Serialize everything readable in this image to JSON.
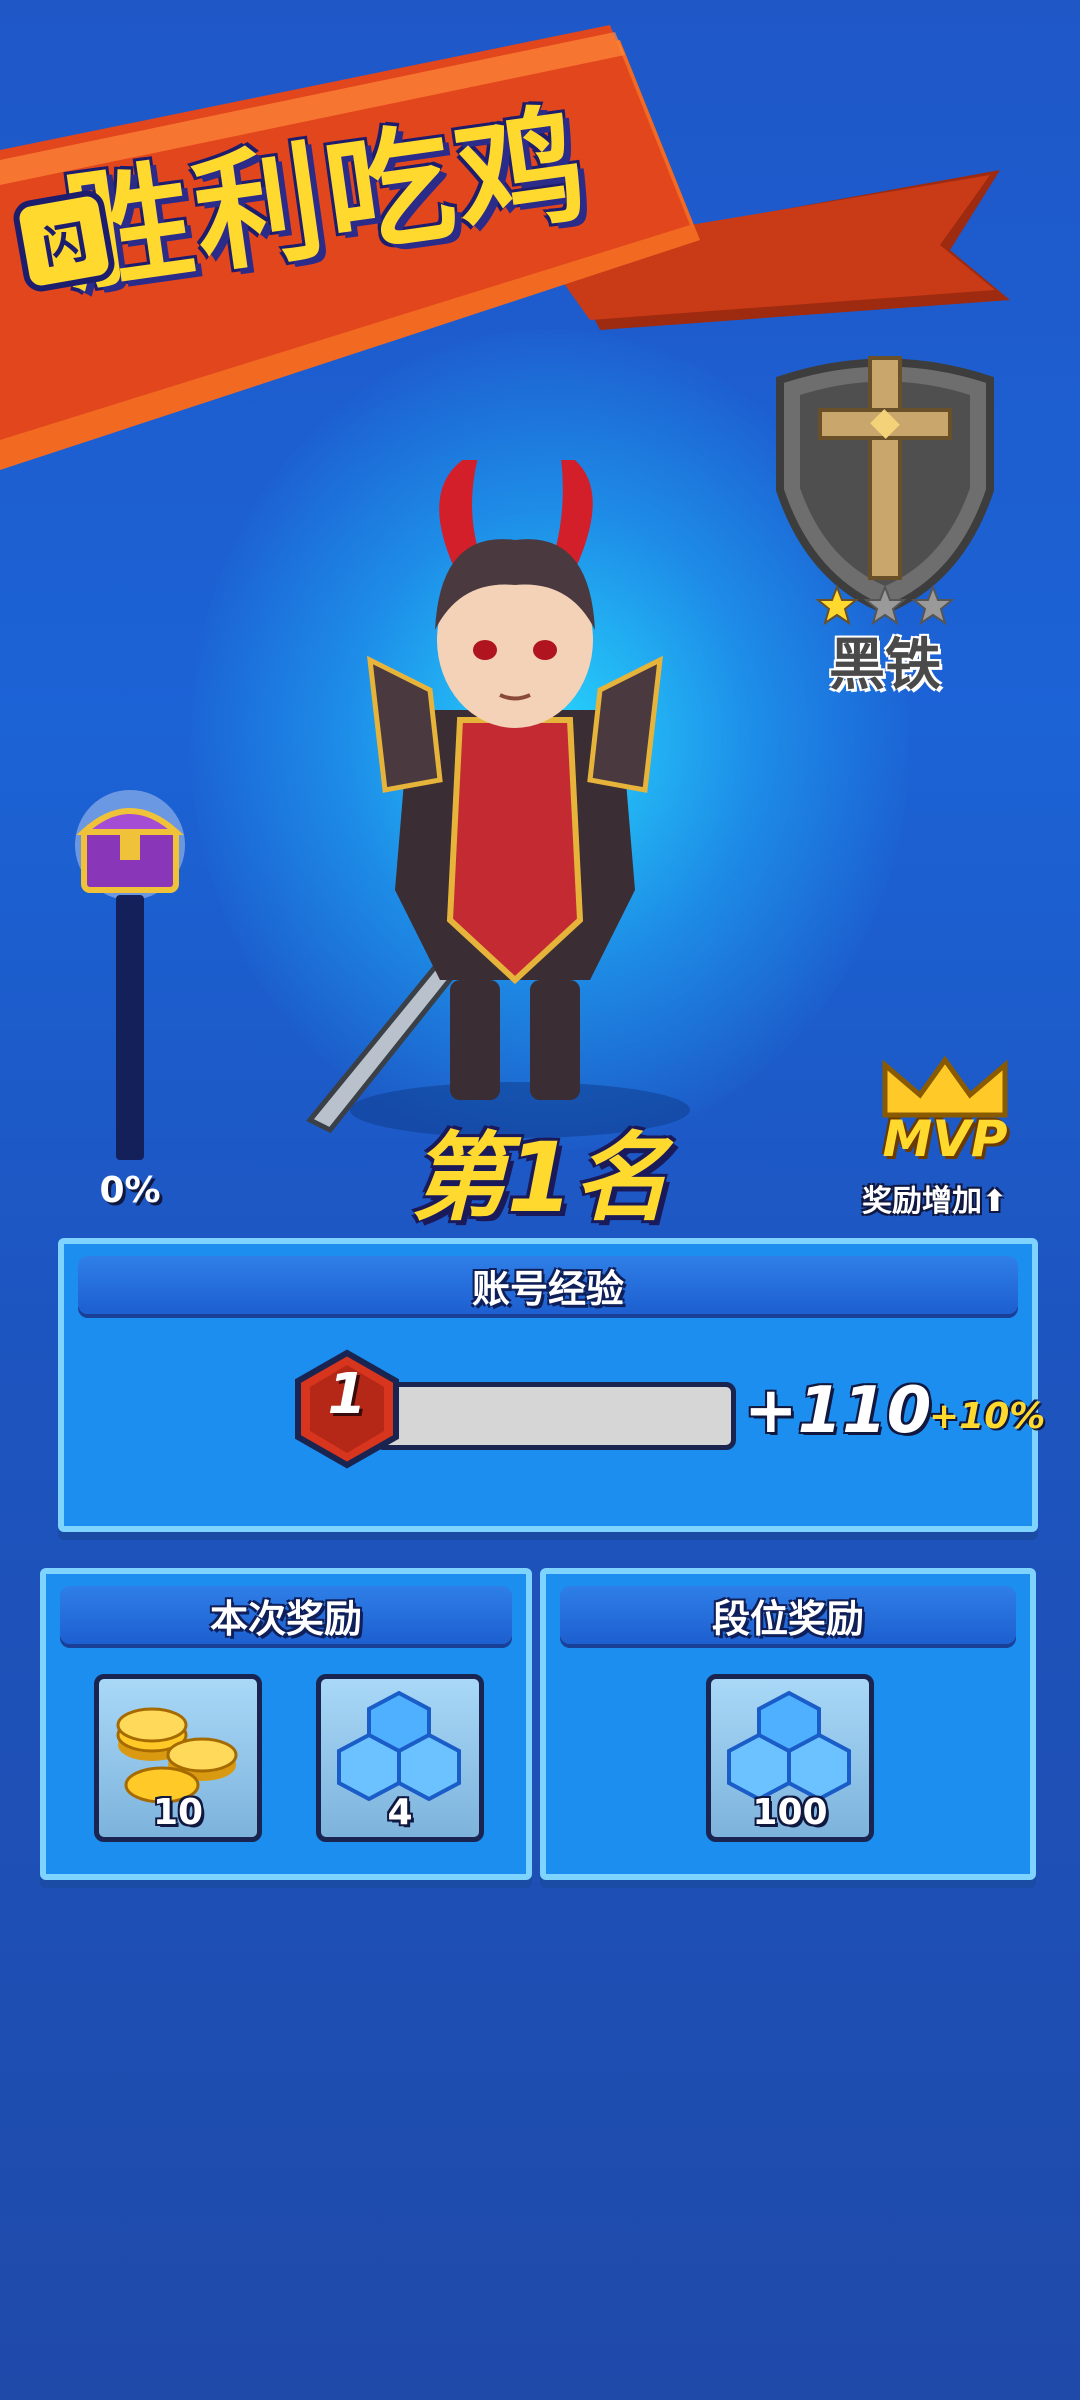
{
  "banner": {
    "badge": "闪",
    "title": "胜利吃鸡"
  },
  "rank": {
    "name": "黑铁",
    "stars_filled": 1,
    "stars_total": 3
  },
  "chest": {
    "progress_label": "0%",
    "progress": 0
  },
  "placement": "第1名",
  "mvp": {
    "label": "MVP",
    "bonus_label": "奖励增加⬆"
  },
  "experience": {
    "title": "账号经验",
    "level": "1",
    "progress": 0,
    "gain": "+110",
    "bonus": "+10%"
  },
  "rewards_this_round": {
    "title": "本次奖励",
    "items": [
      {
        "icon": "gold-coins-icon",
        "quantity": "10"
      },
      {
        "icon": "blue-gems-icon",
        "quantity": "4"
      }
    ]
  },
  "tier_rewards": {
    "title": "段位奖励",
    "items": [
      {
        "icon": "blue-gems-icon",
        "quantity": "100"
      }
    ]
  },
  "colors": {
    "gold": "#ffd92e",
    "panel": "#1b8ef0",
    "ribbon": "#e2461c"
  }
}
